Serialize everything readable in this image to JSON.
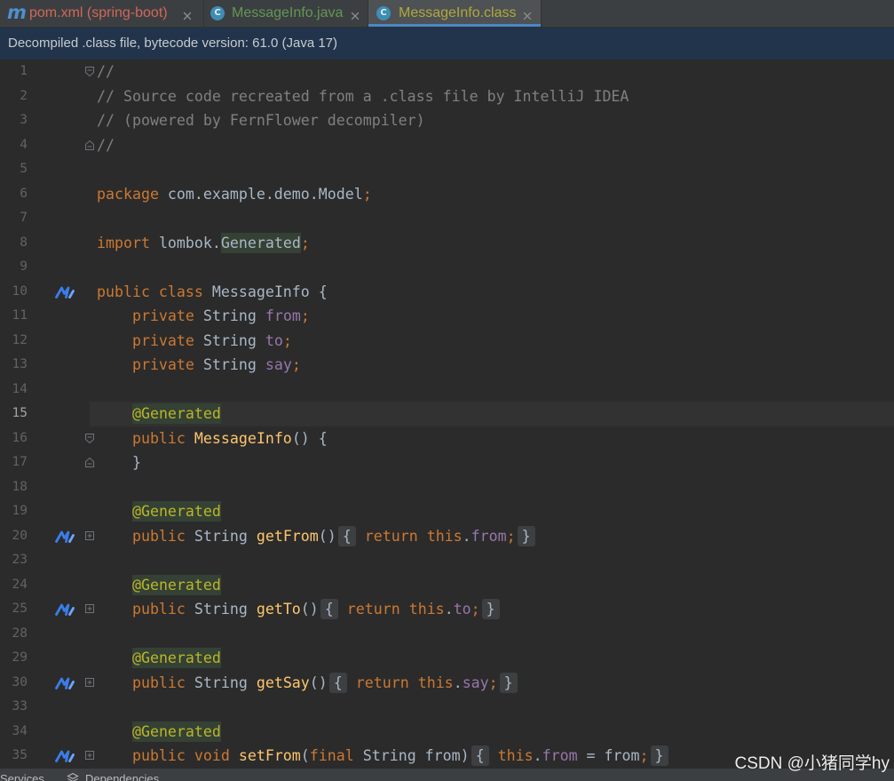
{
  "tabs": [
    {
      "label": "pom.xml (spring-boot)",
      "icon": "maven-icon",
      "icon_glyph": "m",
      "color": "#d1675a",
      "active": false
    },
    {
      "label": "MessageInfo.java",
      "icon": "class-icon",
      "icon_glyph": "C",
      "color": "#629755",
      "active": false
    },
    {
      "label": "MessageInfo.class",
      "icon": "class-icon",
      "icon_glyph": "C",
      "color": "#b0a83c",
      "active": true
    }
  ],
  "banner": {
    "text": "Decompiled .class file, bytecode version: 61.0 (Java 17)"
  },
  "editor": {
    "current_line": 15,
    "lines": [
      {
        "number": "1",
        "fold": "fold-start-icon",
        "tokens": [
          {
            "text": "//",
            "color": "#808080"
          }
        ]
      },
      {
        "number": "2",
        "tokens": [
          {
            "text": "// Source code recreated from a .class file by IntelliJ IDEA",
            "color": "#808080"
          }
        ]
      },
      {
        "number": "3",
        "tokens": [
          {
            "text": "// (powered by FernFlower decompiler)",
            "color": "#808080"
          }
        ]
      },
      {
        "number": "4",
        "fold": "fold-end-icon",
        "tokens": [
          {
            "text": "//",
            "color": "#808080"
          }
        ]
      },
      {
        "number": "5",
        "tokens": []
      },
      {
        "number": "6",
        "tokens": [
          {
            "text": "package",
            "color": "#cc7832"
          },
          {
            "text": " com.example.demo.Model",
            "color": "#a9b7c6"
          },
          {
            "text": ";",
            "color": "#cc7832"
          }
        ]
      },
      {
        "number": "7",
        "tokens": []
      },
      {
        "number": "8",
        "tokens": [
          {
            "text": "import",
            "color": "#cc7832"
          },
          {
            "text": " lombok.",
            "color": "#a9b7c6"
          },
          {
            "text": "Generated",
            "color": "#a9b7c6",
            "hl": true
          },
          {
            "text": ";",
            "color": "#cc7832"
          }
        ]
      },
      {
        "number": "9",
        "tokens": []
      },
      {
        "number": "10",
        "marker": "code-assistant-icon",
        "tokens": [
          {
            "text": "public class",
            "color": "#cc7832"
          },
          {
            "text": " MessageInfo {",
            "color": "#a9b7c6"
          }
        ]
      },
      {
        "number": "11",
        "tokens": [
          {
            "text": "    private",
            "color": "#cc7832"
          },
          {
            "text": " String ",
            "color": "#a9b7c6"
          },
          {
            "text": "from",
            "color": "#9876aa"
          },
          {
            "text": ";",
            "color": "#cc7832"
          }
        ]
      },
      {
        "number": "12",
        "tokens": [
          {
            "text": "    private",
            "color": "#cc7832"
          },
          {
            "text": " String ",
            "color": "#a9b7c6"
          },
          {
            "text": "to",
            "color": "#9876aa"
          },
          {
            "text": ";",
            "color": "#cc7832"
          }
        ]
      },
      {
        "number": "13",
        "tokens": [
          {
            "text": "    private",
            "color": "#cc7832"
          },
          {
            "text": " String ",
            "color": "#a9b7c6"
          },
          {
            "text": "say",
            "color": "#9876aa"
          },
          {
            "text": ";",
            "color": "#cc7832"
          }
        ]
      },
      {
        "number": "14",
        "tokens": []
      },
      {
        "number": "15",
        "tokens": [
          {
            "text": "    ",
            "color": "#a9b7c6"
          },
          {
            "text": "@Generated",
            "color": "#bbb529",
            "hl": true
          }
        ]
      },
      {
        "number": "16",
        "fold": "fold-start-icon",
        "tokens": [
          {
            "text": "    public",
            "color": "#cc7832"
          },
          {
            "text": " ",
            "color": "#a9b7c6"
          },
          {
            "text": "MessageInfo",
            "color": "#ffc66d"
          },
          {
            "text": "() {",
            "color": "#a9b7c6"
          }
        ]
      },
      {
        "number": "17",
        "fold": "fold-end-icon",
        "tokens": [
          {
            "text": "    }",
            "color": "#a9b7c6"
          }
        ]
      },
      {
        "number": "18",
        "tokens": []
      },
      {
        "number": "19",
        "tokens": [
          {
            "text": "    ",
            "color": "#a9b7c6"
          },
          {
            "text": "@Generated",
            "color": "#bbb529",
            "hl": true
          }
        ]
      },
      {
        "number": "20",
        "marker": "code-assistant-icon",
        "fold": "expand-fold-icon",
        "tokens": [
          {
            "text": "    public",
            "color": "#cc7832"
          },
          {
            "text": " String ",
            "color": "#a9b7c6"
          },
          {
            "text": "getFrom",
            "color": "#ffc66d"
          },
          {
            "text": "()",
            "color": "#a9b7c6"
          },
          {
            "text": "{",
            "color": "#a9b7c6",
            "folded": true
          },
          {
            "text": " ",
            "color": "#a9b7c6"
          },
          {
            "text": "return this",
            "color": "#cc7832"
          },
          {
            "text": ".",
            "color": "#a9b7c6"
          },
          {
            "text": "from",
            "color": "#9876aa"
          },
          {
            "text": ";",
            "color": "#cc7832"
          },
          {
            "text": "}",
            "color": "#a9b7c6",
            "folded": true
          }
        ]
      },
      {
        "number": "23",
        "tokens": []
      },
      {
        "number": "24",
        "tokens": [
          {
            "text": "    ",
            "color": "#a9b7c6"
          },
          {
            "text": "@Generated",
            "color": "#bbb529",
            "hl": true
          }
        ]
      },
      {
        "number": "25",
        "marker": "code-assistant-icon",
        "fold": "expand-fold-icon",
        "tokens": [
          {
            "text": "    public",
            "color": "#cc7832"
          },
          {
            "text": " String ",
            "color": "#a9b7c6"
          },
          {
            "text": "getTo",
            "color": "#ffc66d"
          },
          {
            "text": "()",
            "color": "#a9b7c6"
          },
          {
            "text": "{",
            "color": "#a9b7c6",
            "folded": true
          },
          {
            "text": " ",
            "color": "#a9b7c6"
          },
          {
            "text": "return this",
            "color": "#cc7832"
          },
          {
            "text": ".",
            "color": "#a9b7c6"
          },
          {
            "text": "to",
            "color": "#9876aa"
          },
          {
            "text": ";",
            "color": "#cc7832"
          },
          {
            "text": "}",
            "color": "#a9b7c6",
            "folded": true
          }
        ]
      },
      {
        "number": "28",
        "tokens": []
      },
      {
        "number": "29",
        "tokens": [
          {
            "text": "    ",
            "color": "#a9b7c6"
          },
          {
            "text": "@Generated",
            "color": "#bbb529",
            "hl": true
          }
        ]
      },
      {
        "number": "30",
        "marker": "code-assistant-icon",
        "fold": "expand-fold-icon",
        "tokens": [
          {
            "text": "    public",
            "color": "#cc7832"
          },
          {
            "text": " String ",
            "color": "#a9b7c6"
          },
          {
            "text": "getSay",
            "color": "#ffc66d"
          },
          {
            "text": "()",
            "color": "#a9b7c6"
          },
          {
            "text": "{",
            "color": "#a9b7c6",
            "folded": true
          },
          {
            "text": " ",
            "color": "#a9b7c6"
          },
          {
            "text": "return this",
            "color": "#cc7832"
          },
          {
            "text": ".",
            "color": "#a9b7c6"
          },
          {
            "text": "say",
            "color": "#9876aa"
          },
          {
            "text": ";",
            "color": "#cc7832"
          },
          {
            "text": "}",
            "color": "#a9b7c6",
            "folded": true
          }
        ]
      },
      {
        "number": "33",
        "tokens": []
      },
      {
        "number": "34",
        "tokens": [
          {
            "text": "    ",
            "color": "#a9b7c6"
          },
          {
            "text": "@Generated",
            "color": "#bbb529",
            "hl": true
          }
        ]
      },
      {
        "number": "35",
        "marker": "code-assistant-icon",
        "fold": "expand-fold-icon",
        "tokens": [
          {
            "text": "    public void",
            "color": "#cc7832"
          },
          {
            "text": " ",
            "color": "#a9b7c6"
          },
          {
            "text": "setFrom",
            "color": "#ffc66d"
          },
          {
            "text": "(",
            "color": "#a9b7c6"
          },
          {
            "text": "final",
            "color": "#cc7832"
          },
          {
            "text": " String from)",
            "color": "#a9b7c6"
          },
          {
            "text": "{",
            "color": "#a9b7c6",
            "folded": true
          },
          {
            "text": " ",
            "color": "#a9b7c6"
          },
          {
            "text": "this",
            "color": "#cc7832"
          },
          {
            "text": ".",
            "color": "#a9b7c6"
          },
          {
            "text": "from",
            "color": "#9876aa"
          },
          {
            "text": " = from",
            "color": "#a9b7c6"
          },
          {
            "text": ";",
            "color": "#cc7832"
          },
          {
            "text": "}",
            "color": "#a9b7c6",
            "folded": true
          }
        ]
      }
    ]
  },
  "bottom_bar": {
    "items": [
      {
        "label": "Services"
      },
      {
        "label": "Dependencies",
        "icon": "dependencies-icon"
      }
    ]
  },
  "watermark": "CSDN @小猪同学hy"
}
